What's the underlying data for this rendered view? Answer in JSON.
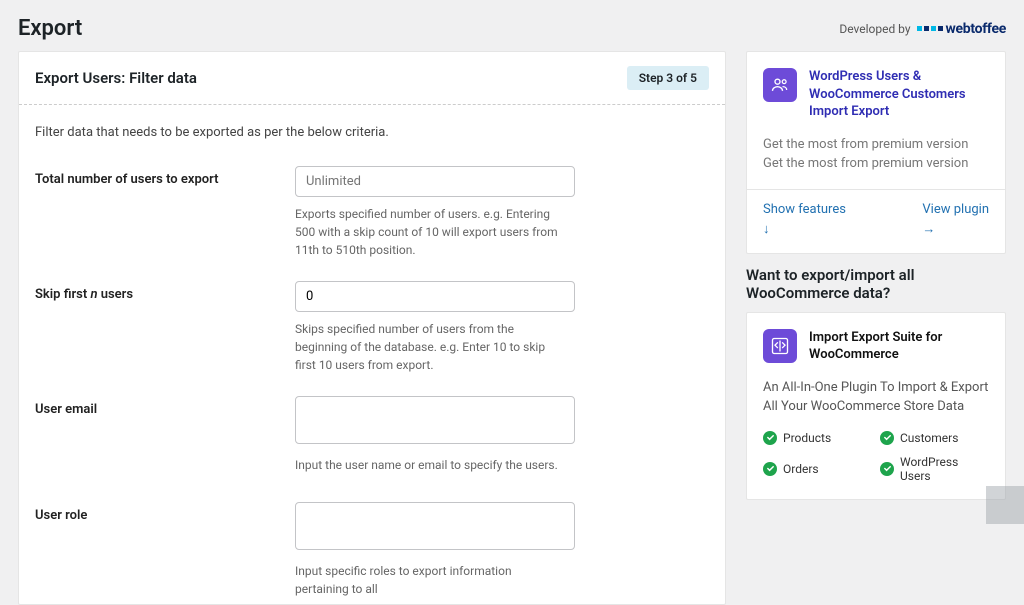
{
  "header": {
    "title": "Export",
    "developed_by": "Developed by",
    "brand": "webtoffee"
  },
  "panel": {
    "title": "Export Users: Filter data",
    "step_badge": "Step 3 of 5",
    "intro": "Filter data that needs to be exported as per the below criteria."
  },
  "fields": {
    "total": {
      "label": "Total number of users to export",
      "placeholder": "Unlimited",
      "help": "Exports specified number of users. e.g. Entering 500 with a skip count of 10 will export users from 11th to 510th position."
    },
    "skip": {
      "label_pre": "Skip first ",
      "label_em": "n",
      "label_post": " users",
      "value": "0",
      "help": "Skips specified number of users from the beginning of the database. e.g. Enter 10 to skip first 10 users from export."
    },
    "email": {
      "label": "User email",
      "help": "Input the user name or email to specify the users."
    },
    "role": {
      "label": "User role",
      "help": "Input specific roles to export information pertaining to all"
    }
  },
  "promo1": {
    "title": "WordPress Users & WooCommerce Customers Import Export",
    "desc": "Get the most from premium version Get the most from premium version",
    "link1": "Show features",
    "link2": "View plugin"
  },
  "mid_heading": "Want to export/import all WooCommerce data?",
  "promo2": {
    "title": "Import Export Suite for WooCommerce",
    "desc": "An All-In-One Plugin To Import & Export All Your WooCommerce Store Data",
    "features": [
      "Products",
      "Customers",
      "Orders",
      "WordPress Users"
    ]
  }
}
